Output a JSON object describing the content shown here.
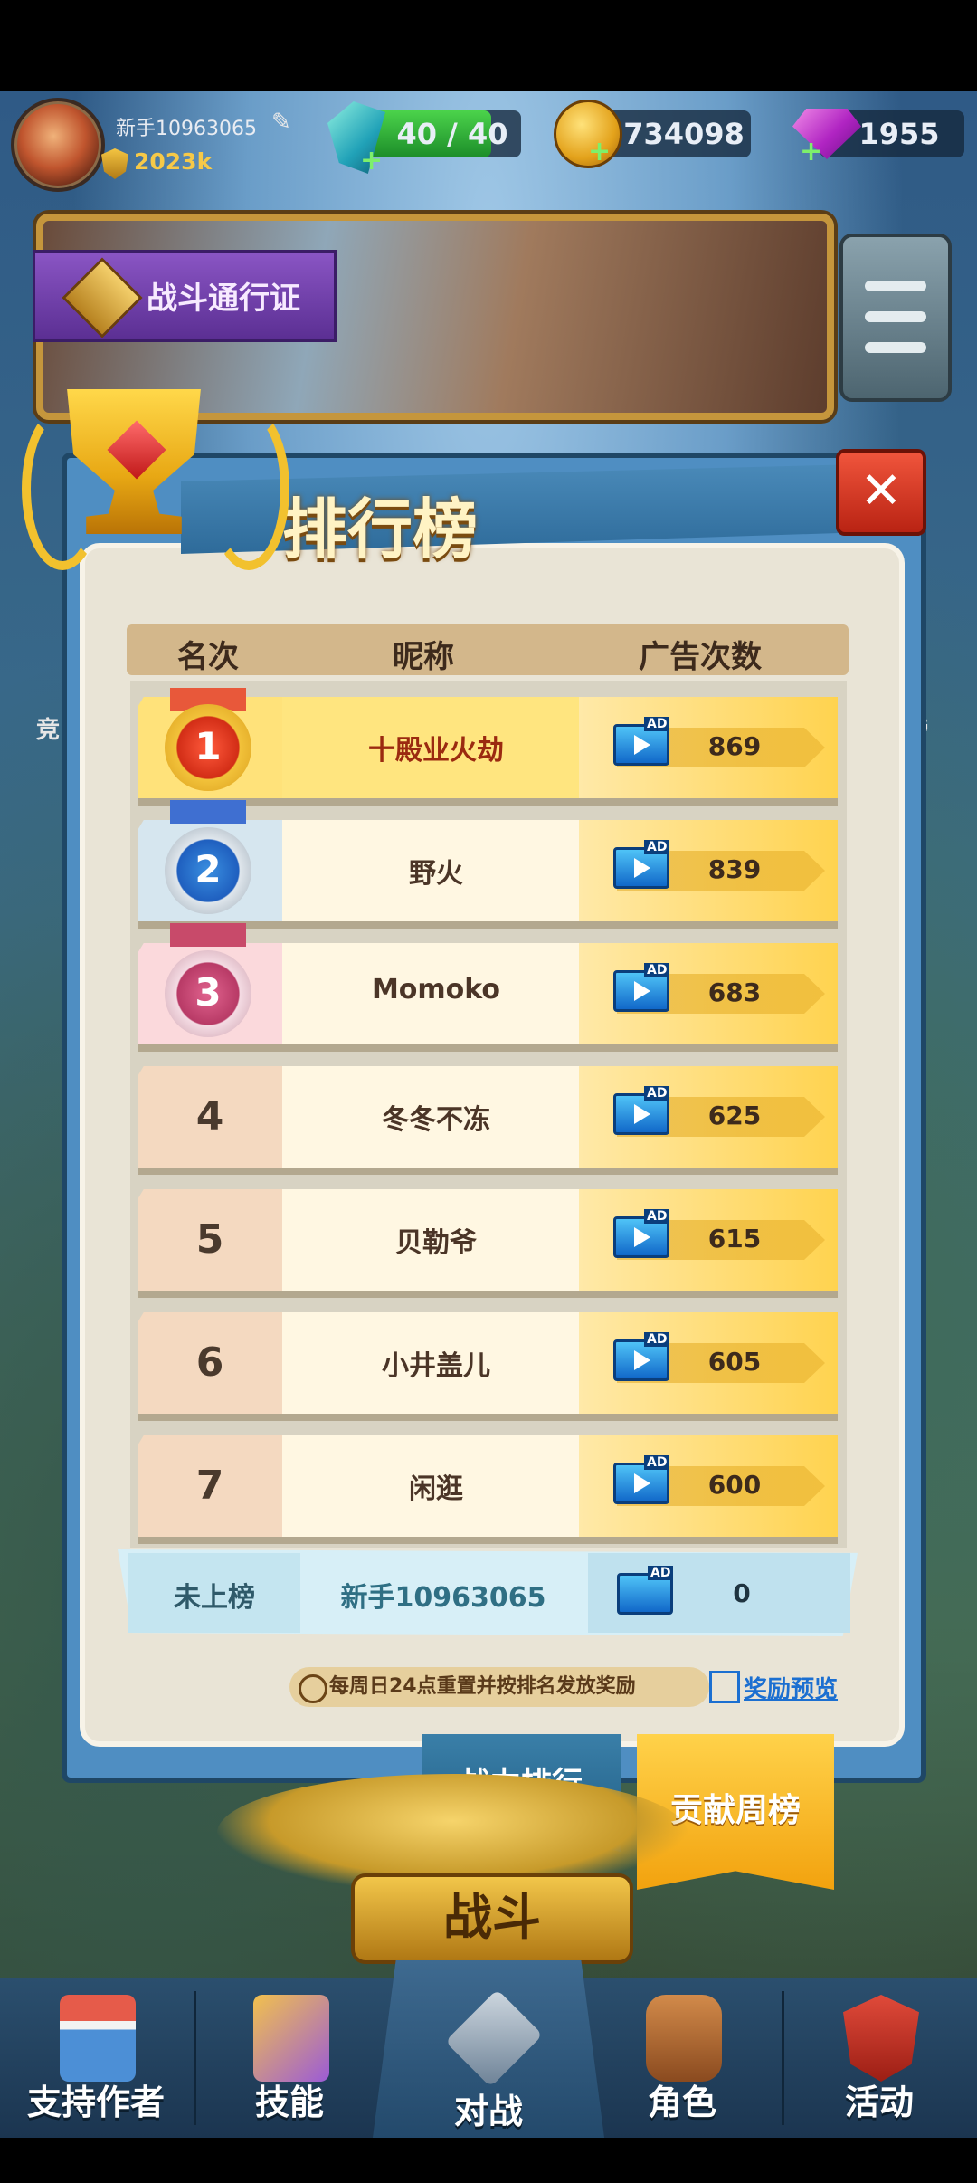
{
  "top_bar": {
    "player_name": "新手10963065",
    "power": "2023k",
    "energy": "40 / 40",
    "energy_level": 1.0,
    "coins": "734098",
    "gems": "1955"
  },
  "banner": {
    "battle_pass_label": "战斗通行证"
  },
  "side": {
    "left_partial": "竞",
    "right_partial": "榜"
  },
  "leaderboard": {
    "title": "排行榜",
    "headers": {
      "rank": "名次",
      "nickname": "昵称",
      "ad_count": "广告次数"
    },
    "ad_badge": "AD",
    "rows": [
      {
        "rank": "1",
        "name": "十殿业火劫",
        "count": "869"
      },
      {
        "rank": "2",
        "name": "野火",
        "count": "839"
      },
      {
        "rank": "3",
        "name": "Momoko",
        "count": "683"
      },
      {
        "rank": "4",
        "name": "冬冬不冻",
        "count": "625"
      },
      {
        "rank": "5",
        "name": "贝勒爷",
        "count": "615"
      },
      {
        "rank": "6",
        "name": "小井盖儿",
        "count": "605"
      },
      {
        "rank": "7",
        "name": "闲逛",
        "count": "600"
      }
    ],
    "self": {
      "status": "未上榜",
      "name": "新手10963065",
      "count": "0"
    },
    "reset_note": "每周日24点重置并按排名发放奖励",
    "reward_preview": "奖励预览"
  },
  "tabs": {
    "power_rank": "战力排行",
    "weekly_contribution": "贡献周榜"
  },
  "battle_button": "战斗",
  "nav": [
    {
      "label": "支持作者",
      "icon": "shop-icon"
    },
    {
      "label": "技能",
      "icon": "skill-book-icon"
    },
    {
      "label": "对战",
      "icon": "crossed-swords-shield-icon"
    },
    {
      "label": "角色",
      "icon": "backpack-icon"
    },
    {
      "label": "活动",
      "icon": "medal-badge-icon"
    }
  ],
  "colors": {
    "gold_row": "#ffd34f",
    "self_row": "#d7eff7",
    "panel_blue": "#4f8ec2",
    "active_tab": "#f2a20e",
    "close_red": "#d93a22"
  }
}
